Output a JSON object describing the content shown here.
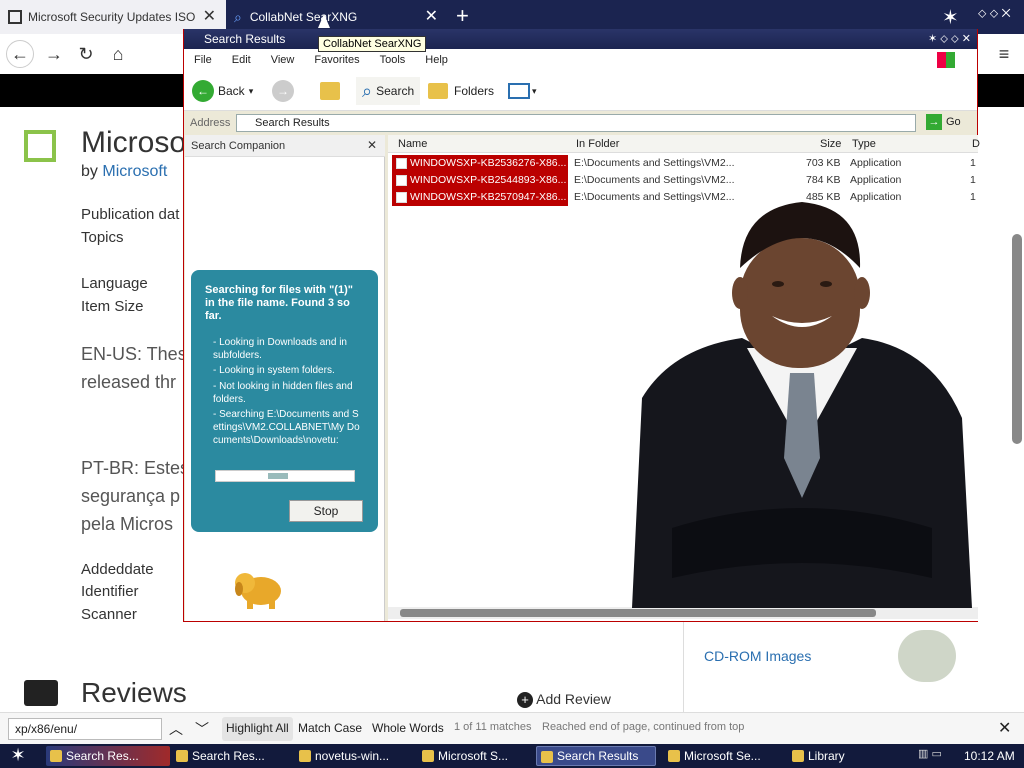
{
  "browser": {
    "tabs": [
      {
        "label": "Microsoft Security Updates ISO ·"
      },
      {
        "label": "CollabNet SearXNG"
      }
    ],
    "tooltip": "CollabNet SearXNG"
  },
  "page": {
    "title": "Microso",
    "by_label": "by",
    "by_author": "Microsoft",
    "meta_labels": [
      "Publication dat",
      "Topics",
      "Language",
      "Item Size"
    ],
    "desc_en": [
      "EN-US: Thes",
      "released thr"
    ],
    "desc_pt": [
      "PT-BR: Estes",
      "segurança p",
      "pela Micros"
    ],
    "meta2_labels": [
      "Addeddate",
      "Identifier",
      "Scanner"
    ],
    "reviews_title": "Reviews",
    "add_review": "Add Review",
    "cdrom_link": "CD-ROM Images"
  },
  "xp": {
    "window_title": "Search Results",
    "menu": [
      "File",
      "Edit",
      "View",
      "Favorites",
      "Tools",
      "Help"
    ],
    "toolbar": {
      "back": "Back",
      "search": "Search",
      "folders": "Folders"
    },
    "address_label": "Address",
    "address_value": "Search Results",
    "go_label": "Go",
    "companion_title": "Search Companion",
    "bubble": {
      "heading": "Searching for files with \"(1)\" in the file name. Found 3 so far.",
      "items": [
        "- Looking in Downloads and in subfolders.",
        "- Looking in system folders.",
        "- Not looking in hidden files and folders.",
        "- Searching E:\\Documents and Settings\\VM2.COLLABNET\\My Documents\\Downloads\\novetu:"
      ],
      "stop_label": "Stop"
    },
    "columns": [
      "Name",
      "In Folder",
      "Size",
      "Type",
      "D"
    ],
    "rows": [
      {
        "name": "WINDOWSXP-KB2536276-X86...",
        "folder": "E:\\Documents and Settings\\VM2...",
        "size": "703 KB",
        "type": "Application",
        "d": "1"
      },
      {
        "name": "WINDOWSXP-KB2544893-X86...",
        "folder": "E:\\Documents and Settings\\VM2...",
        "size": "784 KB",
        "type": "Application",
        "d": "1"
      },
      {
        "name": "WINDOWSXP-KB2570947-X86...",
        "folder": "E:\\Documents and Settings\\VM2...",
        "size": "485 KB",
        "type": "Application",
        "d": "1"
      }
    ]
  },
  "findbar": {
    "query": "xp/x86/enu/",
    "highlight_all": "Highlight All",
    "match_case": "Match Case",
    "whole_words": "Whole Words",
    "matches": "1 of 11 matches",
    "status": "Reached end of page, continued from top"
  },
  "taskbar": {
    "items": [
      "Search Res...",
      "Search Res...",
      "novetus-win...",
      "Microsoft S...",
      "Search Results",
      "Microsoft Se...",
      "Library"
    ],
    "clock": "10:12 AM"
  }
}
